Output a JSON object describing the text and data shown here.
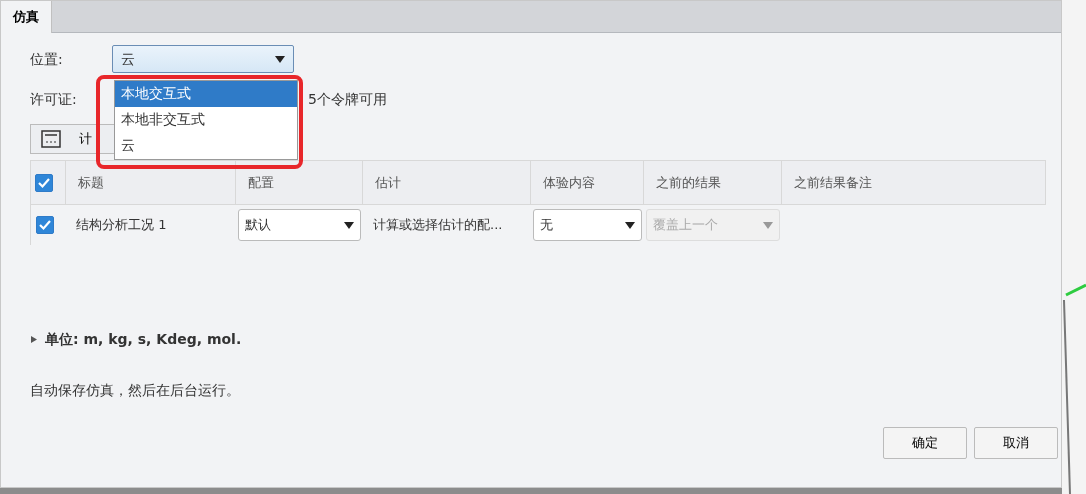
{
  "tabs": [
    {
      "label": "仿真",
      "selected": true
    }
  ],
  "location": {
    "label": "位置:",
    "value": "云",
    "options": [
      {
        "label": "本地交互式",
        "highlighted": true
      },
      {
        "label": "本地非交互式",
        "highlighted": false
      },
      {
        "label": "云",
        "highlighted": false
      }
    ]
  },
  "license": {
    "label": "许可证:",
    "info": "5个令牌可用"
  },
  "calc_button": {
    "label": "计"
  },
  "table": {
    "all_checked": true,
    "columns": [
      "标题",
      "配置",
      "估计",
      "体验内容",
      "之前的结果",
      "之前结果备注"
    ],
    "rows": [
      {
        "checked": true,
        "title": "结构分析工况 1",
        "config": {
          "value": "默认",
          "disabled": false
        },
        "estimate": "计算或选择估计的配...",
        "content": {
          "value": "无",
          "disabled": false
        },
        "previous": {
          "value": "覆盖上一个",
          "disabled": true
        }
      }
    ]
  },
  "units": {
    "expanded": false,
    "text": "单位: m, kg, s, Kdeg, mol."
  },
  "autosave": "自动保存仿真，然后在后台运行。",
  "buttons": [
    "确定",
    "取消"
  ]
}
